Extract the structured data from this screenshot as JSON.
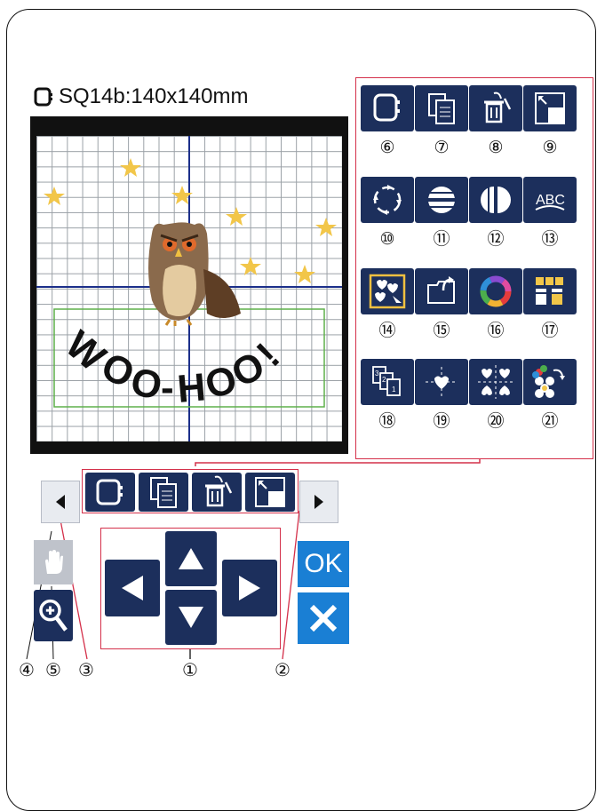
{
  "header": {
    "hoop_label": "SQ14b:140x140mm"
  },
  "canvas": {
    "design_text": "WOO-HOO!"
  },
  "function_panel": {
    "buttons": [
      {
        "label": "⑥",
        "icon": "hoop-icon"
      },
      {
        "label": "⑦",
        "icon": "copy-icon"
      },
      {
        "label": "⑧",
        "icon": "delete-icon"
      },
      {
        "label": "⑨",
        "icon": "resize-icon"
      },
      {
        "label": "⑩",
        "icon": "rotate-icon"
      },
      {
        "label": "⑪",
        "icon": "flip-horizontal-icon"
      },
      {
        "label": "⑫",
        "icon": "flip-vertical-icon"
      },
      {
        "label": "⑬",
        "icon": "arc-text-icon"
      },
      {
        "label": "⑭",
        "icon": "group-icon"
      },
      {
        "label": "⑮",
        "icon": "open-folder-icon"
      },
      {
        "label": "⑯",
        "icon": "color-wheel-icon"
      },
      {
        "label": "⑰",
        "icon": "color-grouping-icon"
      },
      {
        "label": "⑱",
        "icon": "sewing-order-icon"
      },
      {
        "label": "⑲",
        "icon": "center-icon"
      },
      {
        "label": "⑳",
        "icon": "corner-layout-icon"
      },
      {
        "label": "㉑",
        "icon": "color-change-icon"
      }
    ]
  },
  "callouts": {
    "c1": "①",
    "c2": "②",
    "c3": "③",
    "c4": "④",
    "c5": "⑤"
  },
  "controls": {
    "ok_label": "OK"
  },
  "colors": {
    "button_bg": "#1c2f5c",
    "accent_blue": "#1a7fd4",
    "frame_red": "#d4304a"
  }
}
